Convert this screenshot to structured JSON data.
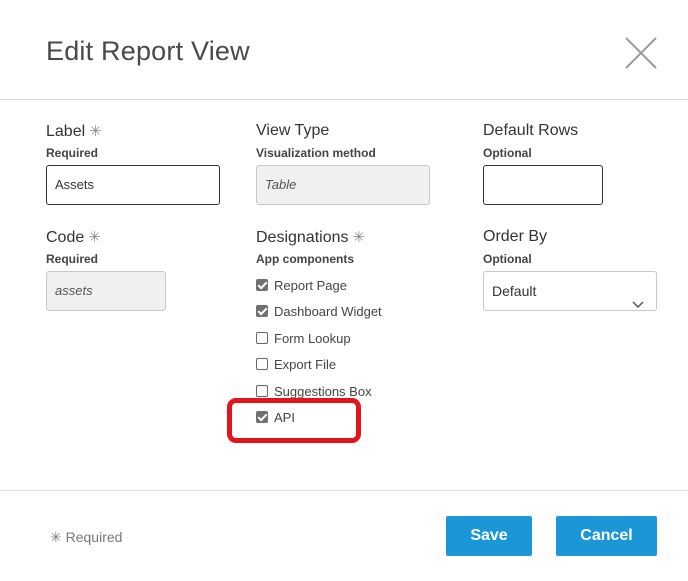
{
  "dialog": {
    "title": "Edit Report View"
  },
  "fields": {
    "label": {
      "label": "Label",
      "asterisk": "✳",
      "hint": "Required",
      "value": "Assets"
    },
    "view_type": {
      "label": "View Type",
      "hint": "Visualization method",
      "value": "Table"
    },
    "default_rows": {
      "label": "Default Rows",
      "hint": "Optional",
      "value": ""
    },
    "code": {
      "label": "Code",
      "asterisk": "✳",
      "hint": "Required",
      "value": "assets"
    },
    "designations": {
      "label": "Designations",
      "asterisk": "✳",
      "hint": "App components",
      "options": [
        {
          "label": "Report Page",
          "checked": true
        },
        {
          "label": "Dashboard Widget",
          "checked": true
        },
        {
          "label": "Form Lookup",
          "checked": false
        },
        {
          "label": "Export File",
          "checked": false
        },
        {
          "label": "Suggestions Box",
          "checked": false
        },
        {
          "label": "API",
          "checked": true
        }
      ]
    },
    "order_by": {
      "label": "Order By",
      "hint": "Optional",
      "value": "Default"
    }
  },
  "footer": {
    "required_note": "✳ Required",
    "save_label": "Save",
    "cancel_label": "Cancel"
  },
  "colors": {
    "primary_button": "#1b96d6",
    "highlight": "#e5141b"
  },
  "icons": [
    "close-icon",
    "chevron-down-icon",
    "checkbox-checked-icon",
    "checkbox-unchecked-icon"
  ]
}
